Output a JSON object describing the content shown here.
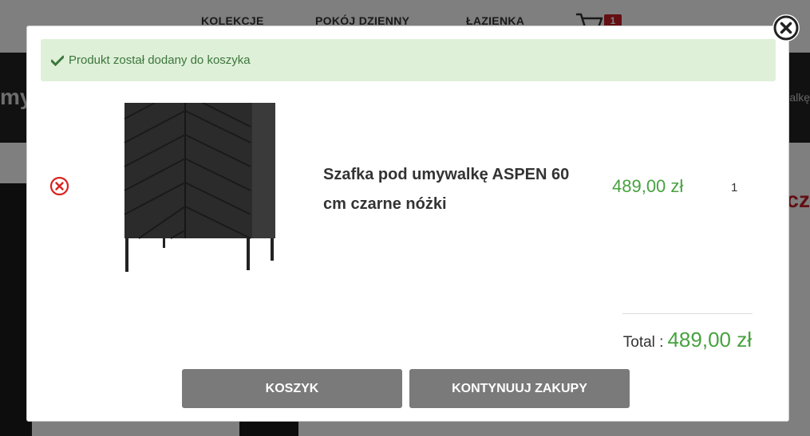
{
  "background": {
    "nav": [
      "KOLEKCJE",
      "POKÓJ DZIENNY",
      "ŁAZIENKA"
    ],
    "cart_count": "1",
    "band_left_text": "myw",
    "band_right_text": "alkę",
    "red_text": "cz"
  },
  "modal": {
    "alert_text": "Produkt został dodany do koszyka",
    "product": {
      "name": "Szafka pod umywalkę ASPEN 60 cm czarne nóżki",
      "price": "489,00 zł",
      "quantity": "1"
    },
    "total_label": "Total :",
    "total_value": "489,00 zł",
    "buttons": {
      "cart": "KOSZYK",
      "continue": "KONTYNUUJ ZAKUPY"
    }
  },
  "colors": {
    "price_green": "#47a23f",
    "alert_bg": "#dff0d8",
    "alert_text": "#3c763d",
    "button_gray": "#7a7a7a",
    "remove_red": "#d9231f"
  },
  "icons": {
    "alert": "check-icon",
    "remove": "remove-circle-icon",
    "close": "close-circle-icon",
    "cart": "cart-icon"
  }
}
